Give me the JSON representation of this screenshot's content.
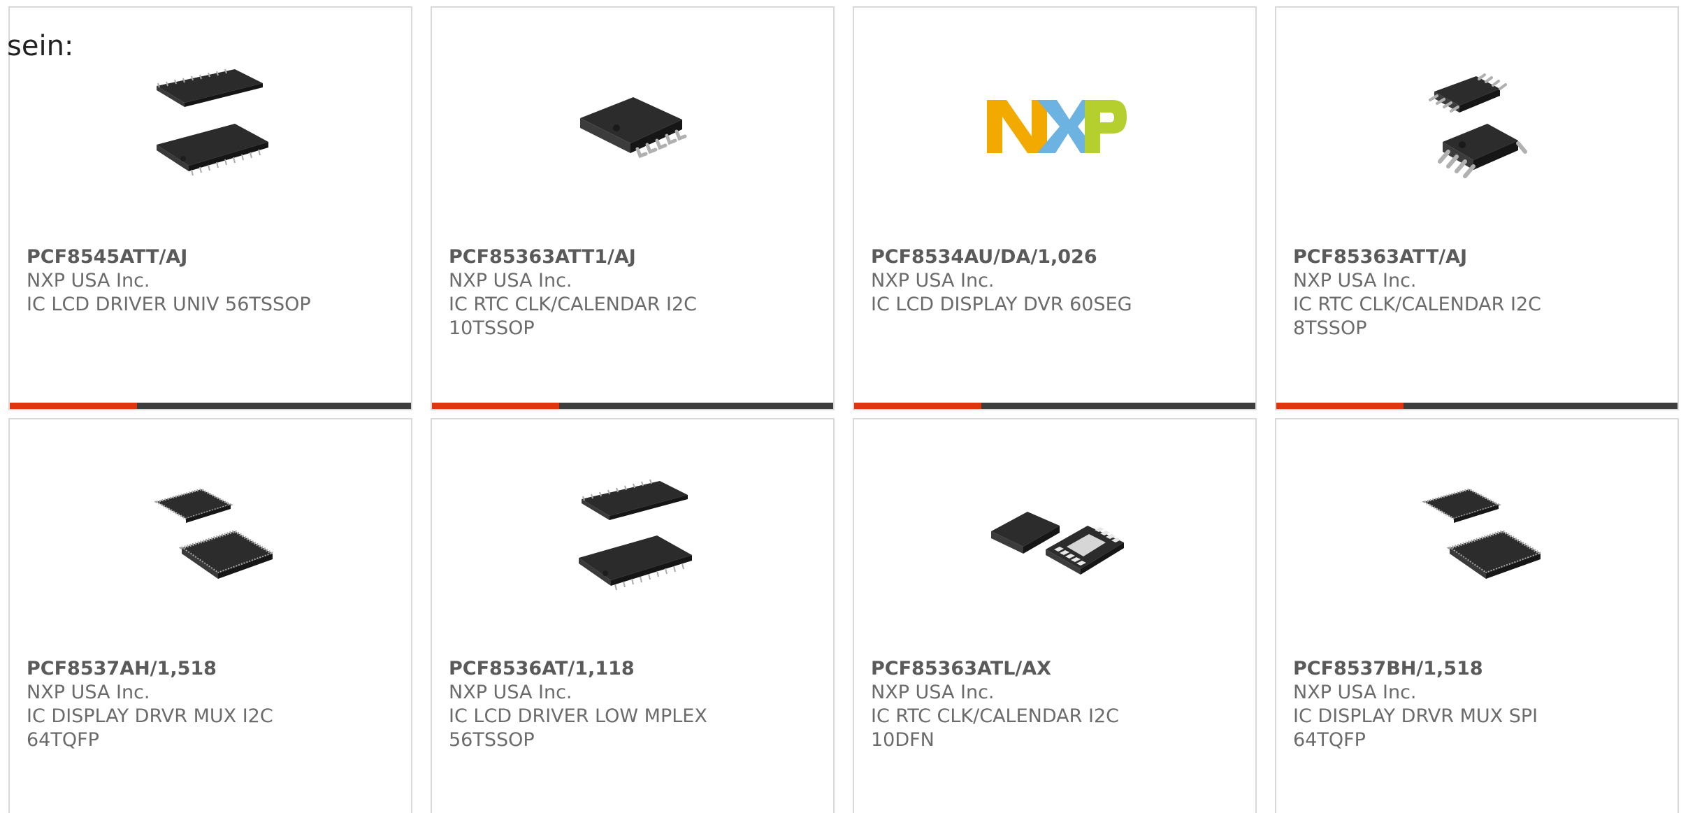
{
  "intro": "sein:",
  "products": [
    {
      "part": "PCF8545ATT/AJ",
      "mfr": "NXP USA Inc.",
      "desc1": "IC LCD DRIVER UNIV 56TSSOP",
      "desc2": "",
      "image": "tssop-twin-chip-image"
    },
    {
      "part": "PCF85363ATT1/AJ",
      "mfr": "NXP USA Inc.",
      "desc1": "IC RTC CLK/CALENDAR I2C",
      "desc2": "10TSSOP",
      "image": "tssop10-chip-image"
    },
    {
      "part": "PCF8534AU/DA/1,026",
      "mfr": "NXP USA Inc.",
      "desc1": "IC LCD DISPLAY DVR 60SEG",
      "desc2": "",
      "image": "nxp-logo"
    },
    {
      "part": "PCF85363ATT/AJ",
      "mfr": "NXP USA Inc.",
      "desc1": "IC RTC CLK/CALENDAR I2C",
      "desc2": "8TSSOP",
      "image": "tssop8-twin-chip-image"
    },
    {
      "part": "PCF8537AH/1,518",
      "mfr": "NXP USA Inc.",
      "desc1": "IC DISPLAY DRVR MUX I2C",
      "desc2": "64TQFP",
      "image": "tqfp-twin-chip-image"
    },
    {
      "part": "PCF8536AT/1,118",
      "mfr": "NXP USA Inc.",
      "desc1": "IC LCD DRIVER LOW MPLEX",
      "desc2": "56TSSOP",
      "image": "tssop-twin-chip-image"
    },
    {
      "part": "PCF85363ATL/AX",
      "mfr": "NXP USA Inc.",
      "desc1": "IC RTC CLK/CALENDAR I2C",
      "desc2": "10DFN",
      "image": "dfn-twin-chip-image"
    },
    {
      "part": "PCF8537BH/1,518",
      "mfr": "NXP USA Inc.",
      "desc1": "IC DISPLAY DRVR MUX SPI",
      "desc2": "64TQFP",
      "image": "tqfp-twin-chip-image"
    }
  ],
  "colors": {
    "accent_bar": "#e0360f",
    "dark_bar": "#3d3d3d",
    "card_border": "#d9d9d9",
    "text": "#6b6b6b",
    "nxp_yellow": "#f2a900",
    "nxp_blue": "#6db3e2",
    "nxp_green": "#b5cf2f"
  }
}
